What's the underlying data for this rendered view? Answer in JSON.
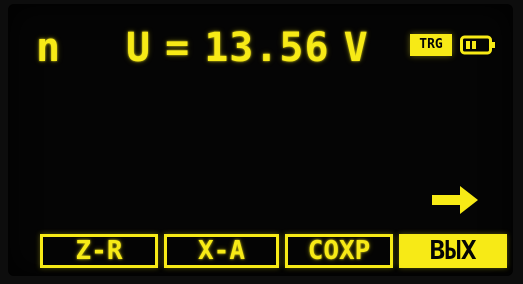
{
  "display": {
    "mode_indicator": "n",
    "voltage": {
      "symbol": "U",
      "equals": "=",
      "value": "13.56",
      "unit": "V"
    },
    "trigger_badge": "TRG",
    "battery_icon": "battery-icon",
    "arrow_icon": "arrow-right-icon"
  },
  "softkeys": [
    {
      "label": "Z-R",
      "selected": false
    },
    {
      "label": "X-A",
      "selected": false
    },
    {
      "label": "СОХР",
      "selected": false
    },
    {
      "label": "ВЫХ",
      "selected": true
    }
  ],
  "colors": {
    "foreground": "#f7ea16",
    "background": "#050505"
  }
}
